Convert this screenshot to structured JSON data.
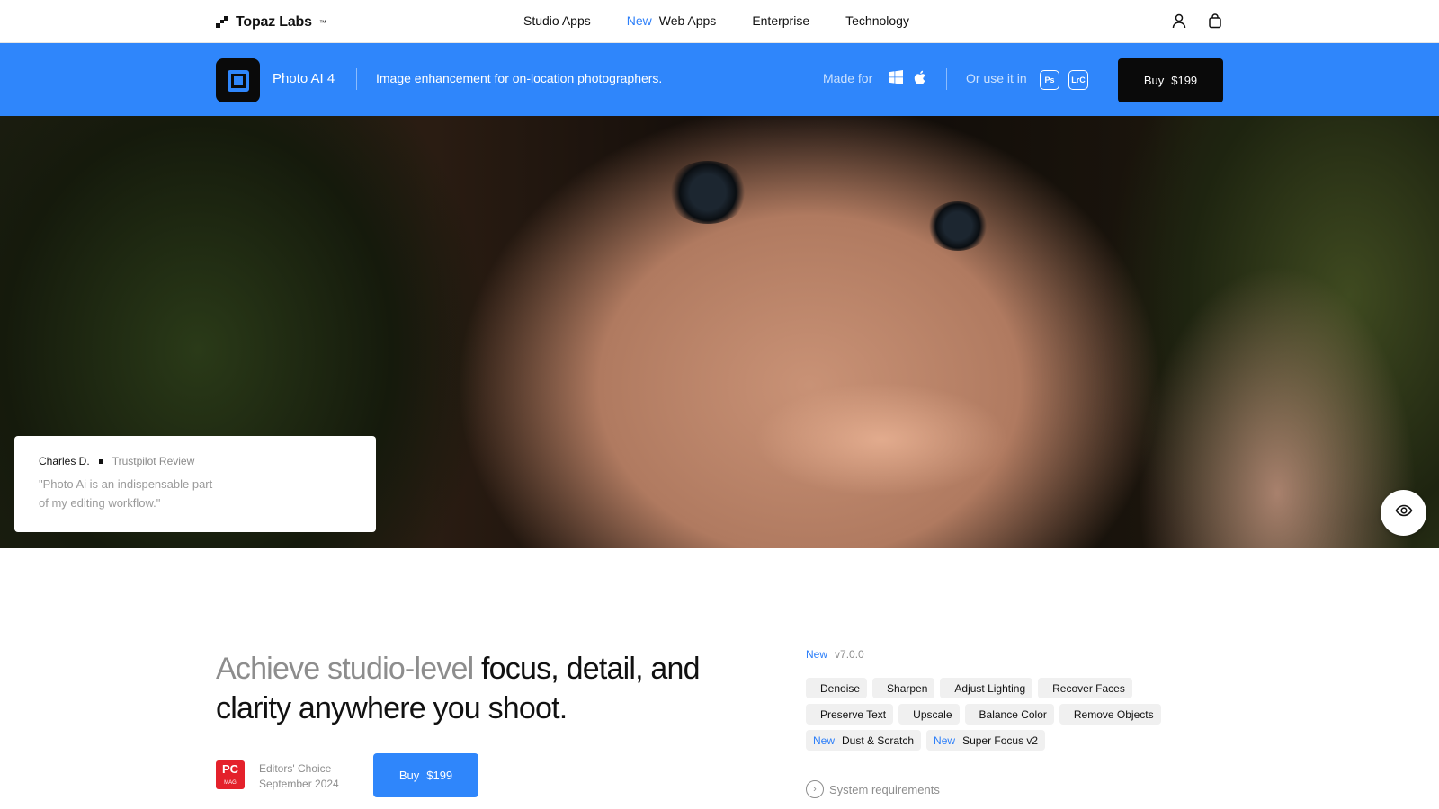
{
  "nav": {
    "logo_text": "Topaz Labs",
    "logo_tm": "™",
    "links": [
      "Studio Apps",
      "Web Apps",
      "Enterprise",
      "Technology"
    ],
    "new_badge": "New",
    "icons": [
      "user-icon",
      "bag-icon"
    ]
  },
  "product_bar": {
    "app_name": "Photo AI 4",
    "tagline": "Image enhancement for on-location photographers.",
    "made_for_label": "Made for",
    "os_icons": [
      "windows-icon",
      "apple-icon"
    ],
    "or_use_label": "Or use it in",
    "plugins": [
      "Ps",
      "LrC"
    ],
    "buy_label": "Buy",
    "buy_price": "$199",
    "bg_color": "#2f86fb"
  },
  "hero": {
    "review": {
      "name": "Charles D.",
      "source": "Trustpilot Review",
      "quote": "\"Photo Ai is an indispensable part of my editing workflow.\""
    },
    "toggle_icon": "eye-icon"
  },
  "main": {
    "headline_muted": "Achieve studio-level",
    "headline_rest": " focus, detail, and clarity anywhere you shoot.",
    "award_badge_top": "PC",
    "award_badge_bottom": "MAG",
    "award_line1": "Editors' Choice",
    "award_line2": "September 2024",
    "buy_label": "Buy",
    "buy_price": "$199"
  },
  "features": {
    "new_label": "New",
    "version": "v7.0.0",
    "tags": [
      {
        "label": "Denoise",
        "new": ""
      },
      {
        "label": "Sharpen",
        "new": ""
      },
      {
        "label": "Adjust Lighting",
        "new": ""
      },
      {
        "label": "Recover Faces",
        "new": ""
      },
      {
        "label": "Preserve Text",
        "new": ""
      },
      {
        "label": "Upscale",
        "new": ""
      },
      {
        "label": "Balance Color",
        "new": ""
      },
      {
        "label": "Remove Objects",
        "new": ""
      },
      {
        "label": "Dust & Scratch",
        "new": "New"
      },
      {
        "label": "Super Focus v2",
        "new": "New"
      }
    ],
    "system_req_label": "System requirements"
  }
}
